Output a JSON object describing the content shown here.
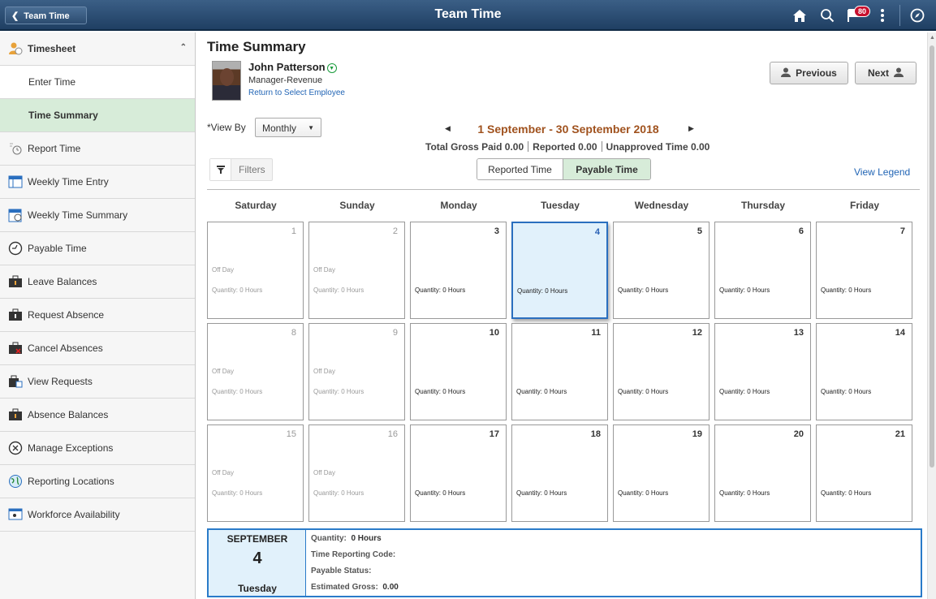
{
  "banner": {
    "back_label": "Team Time",
    "title": "Team Time",
    "notification_count": "80"
  },
  "sidebar": {
    "items": [
      {
        "label": "Timesheet"
      },
      {
        "label": "Enter Time"
      },
      {
        "label": "Time Summary"
      },
      {
        "label": "Report Time"
      },
      {
        "label": "Weekly Time Entry"
      },
      {
        "label": "Weekly Time Summary"
      },
      {
        "label": "Payable Time"
      },
      {
        "label": "Leave Balances"
      },
      {
        "label": "Request Absence"
      },
      {
        "label": "Cancel Absences"
      },
      {
        "label": "View Requests"
      },
      {
        "label": "Absence Balances"
      },
      {
        "label": "Manage Exceptions"
      },
      {
        "label": "Reporting Locations"
      },
      {
        "label": "Workforce Availability"
      }
    ]
  },
  "main": {
    "title": "Time Summary",
    "employee": {
      "name": "John Patterson",
      "title": "Manager-Revenue",
      "return_link": "Return to Select Employee"
    },
    "previous_label": "Previous",
    "next_label": "Next",
    "view_by_label": "*View By",
    "view_by_value": "Monthly",
    "period": "1 September - 30 September 2018",
    "totals": {
      "gross": "Total Gross Paid  0.00",
      "reported": "Reported  0.00",
      "unapproved": "Unapproved Time  0.00"
    },
    "filters_label": "Filters",
    "segments": [
      "Reported Time",
      "Payable Time"
    ],
    "legend_link": "View Legend",
    "weekdays": [
      "Saturday",
      "Sunday",
      "Monday",
      "Tuesday",
      "Wednesday",
      "Thursday",
      "Friday"
    ],
    "calendar": [
      [
        {
          "day": "1",
          "off": "Off Day",
          "qty": "Quantity: 0 Hours"
        },
        {
          "day": "2",
          "off": "Off Day",
          "qty": "Quantity: 0 Hours"
        },
        {
          "day": "3",
          "off": "",
          "qty": "Quantity: 0 Hours"
        },
        {
          "day": "4",
          "off": "",
          "qty": "Quantity: 0 Hours"
        },
        {
          "day": "5",
          "off": "",
          "qty": "Quantity: 0 Hours"
        },
        {
          "day": "6",
          "off": "",
          "qty": "Quantity: 0 Hours"
        },
        {
          "day": "7",
          "off": "",
          "qty": "Quantity: 0 Hours"
        }
      ],
      [
        {
          "day": "8",
          "off": "Off Day",
          "qty": "Quantity: 0 Hours"
        },
        {
          "day": "9",
          "off": "Off Day",
          "qty": "Quantity: 0 Hours"
        },
        {
          "day": "10",
          "off": "",
          "qty": "Quantity: 0 Hours"
        },
        {
          "day": "11",
          "off": "",
          "qty": "Quantity: 0 Hours"
        },
        {
          "day": "12",
          "off": "",
          "qty": "Quantity: 0 Hours"
        },
        {
          "day": "13",
          "off": "",
          "qty": "Quantity: 0 Hours"
        },
        {
          "day": "14",
          "off": "",
          "qty": "Quantity: 0 Hours"
        }
      ],
      [
        {
          "day": "15",
          "off": "Off Day",
          "qty": "Quantity: 0 Hours"
        },
        {
          "day": "16",
          "off": "Off Day",
          "qty": "Quantity: 0 Hours"
        },
        {
          "day": "17",
          "off": "",
          "qty": "Quantity: 0 Hours"
        },
        {
          "day": "18",
          "off": "",
          "qty": "Quantity: 0 Hours"
        },
        {
          "day": "19",
          "off": "",
          "qty": "Quantity: 0 Hours"
        },
        {
          "day": "20",
          "off": "",
          "qty": "Quantity: 0 Hours"
        },
        {
          "day": "21",
          "off": "",
          "qty": "Quantity: 0 Hours"
        }
      ]
    ],
    "detail": {
      "month": "SEPTEMBER",
      "day": "4",
      "weekday": "Tuesday",
      "quantity_label": "Quantity:",
      "quantity_value": "0 Hours",
      "trc_label": "Time Reporting Code:",
      "status_label": "Payable Status:",
      "gross_label": "Estimated Gross:",
      "gross_value": "0.00"
    }
  },
  "colors": {
    "banner": "#2c4c70",
    "selected": "#d7ecd9",
    "today": "#e1f1fb",
    "link": "#2265b5",
    "period": "#a0521e"
  }
}
